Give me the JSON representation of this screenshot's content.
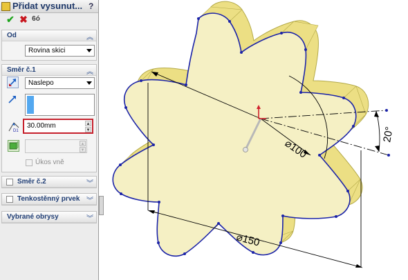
{
  "property_manager": {
    "title": "Přidat vysunut...",
    "help": "?",
    "actions": {
      "ok": "✔",
      "cancel": "✖",
      "preview": "6ó"
    },
    "from": {
      "label": "Od",
      "value": "Rovina skici"
    },
    "direction1": {
      "label": "Směr č.1",
      "end_condition": "Naslepo",
      "depth": "30.00mm",
      "draft_label": "Úkos vně"
    },
    "direction2": {
      "label": "Směr č.2"
    },
    "thin_feature": {
      "label": "Tenkostěnný prvek"
    },
    "selected_contours": {
      "label": "Vybrané obrysy"
    }
  },
  "dimensions": {
    "outer_diameter": "150",
    "inner_diameter": "100",
    "angle": "20°"
  },
  "colors": {
    "face": "#f5f0c4",
    "side": "#ecdf84",
    "edge": "#1b23a8",
    "depth_border": "#c6202c",
    "title_text": "#1d3768"
  }
}
